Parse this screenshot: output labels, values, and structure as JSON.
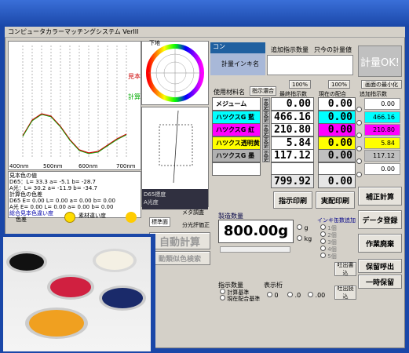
{
  "window": {
    "title": "コンピュータカラーマッチングシステム VerIII"
  },
  "chart": {
    "left_labels": [
      "見本",
      "計算"
    ],
    "x_ticks": [
      "400nm",
      "500nm",
      "600nm",
      "700nm"
    ],
    "top_label": "下地"
  },
  "color_info": {
    "header": "見本色の値",
    "sample_d65": "D65：L= 33.3 a= -5.1 b= -28.7",
    "sample_a": "A光：L= 30.2 a= -11.9 b= -34.7",
    "calc_header": "計算色の色差",
    "calc_d65": "D65 E= 0.00 L= 0.00 a= 0.00 b= 0.00",
    "calc_a": "A光 E= 0.00 L= 0.00 a= 0.00 b= 0.00",
    "total_label": "総合見本色違い度",
    "color_diff": "色差",
    "material_diff": "素材違い度",
    "standard": "標準面",
    "meta_label": "メタ調査",
    "spectral": "分光評価正"
  },
  "scope": {
    "d65_label": "D65標度",
    "a_label": "A光度"
  },
  "header": {
    "tag": "コン",
    "add_instruct": "追加指示数量",
    "current_qty": "只今の計量値",
    "qty_label": "計量インキ名",
    "ok": "計量OK!"
  },
  "table": {
    "used_material": "使用材料名",
    "instruct_mix": "指示濃合",
    "pct1": "100%",
    "pct2": "100%",
    "maximize": "画面の最小化",
    "col_final": "最終指示数",
    "col_current": "現在の配合",
    "col_add": "追加指示数",
    "rows": [
      {
        "name": "メジューム",
        "color": "#ffffff",
        "final": "0.00",
        "cur": "0.00",
        "add": "0.00",
        "curbg": "#ffffff"
      },
      {
        "name": "ハツクスG 藍",
        "color": "#00ffff",
        "final": "466.16",
        "cur": "0.00",
        "add": "466.16",
        "curbg": "#00ffff"
      },
      {
        "name": "ハツクスG 紅",
        "color": "#ff00ff",
        "final": "210.80",
        "cur": "0.00",
        "add": "210.80",
        "curbg": "#ff00ff"
      },
      {
        "name": "ハツクス透明黄",
        "color": "#ffff00",
        "final": "5.84",
        "cur": "0.00",
        "add": "5.84",
        "curbg": "#ffff00"
      },
      {
        "name": "ハツクスG 墨",
        "color": "#b0b0b0",
        "final": "117.12",
        "cur": "0.00",
        "add": "117.12",
        "curbg": "#c0c0c0"
      },
      {
        "name": "",
        "color": "#ffffff",
        "final": "",
        "cur": "",
        "add": "0.00",
        "curbg": "#ffffff"
      }
    ],
    "change": "変更",
    "total": "799.92",
    "total_cur": "0.00"
  },
  "buttons": {
    "print_instr": "指示印刷",
    "print_mix": "実配印刷",
    "correct_calc": "補正計算",
    "data_reg": "データ登録",
    "discard": "作業廃棄",
    "save_call": "保留呼出",
    "temp_save": "一時保留",
    "auto_calc": "自動計算",
    "auto_similar": "動類似色検索",
    "save_write": "吐出書込",
    "save_read": "吐出読込"
  },
  "production": {
    "label": "製造数量",
    "value": "800.00g",
    "unit_g": "g",
    "unit_kg": "kg",
    "ink_label": "インキ缶数追加",
    "slots": [
      "1個",
      "2個",
      "3個",
      "4個",
      "5個"
    ]
  },
  "instruct": {
    "label": "指示数量",
    "calc": "計算基準",
    "current": "現在配合基準"
  },
  "display": {
    "label": "表示桁",
    "opts": [
      "0",
      ".0",
      ".00"
    ]
  },
  "photo": {
    "alt": "ink cans"
  }
}
